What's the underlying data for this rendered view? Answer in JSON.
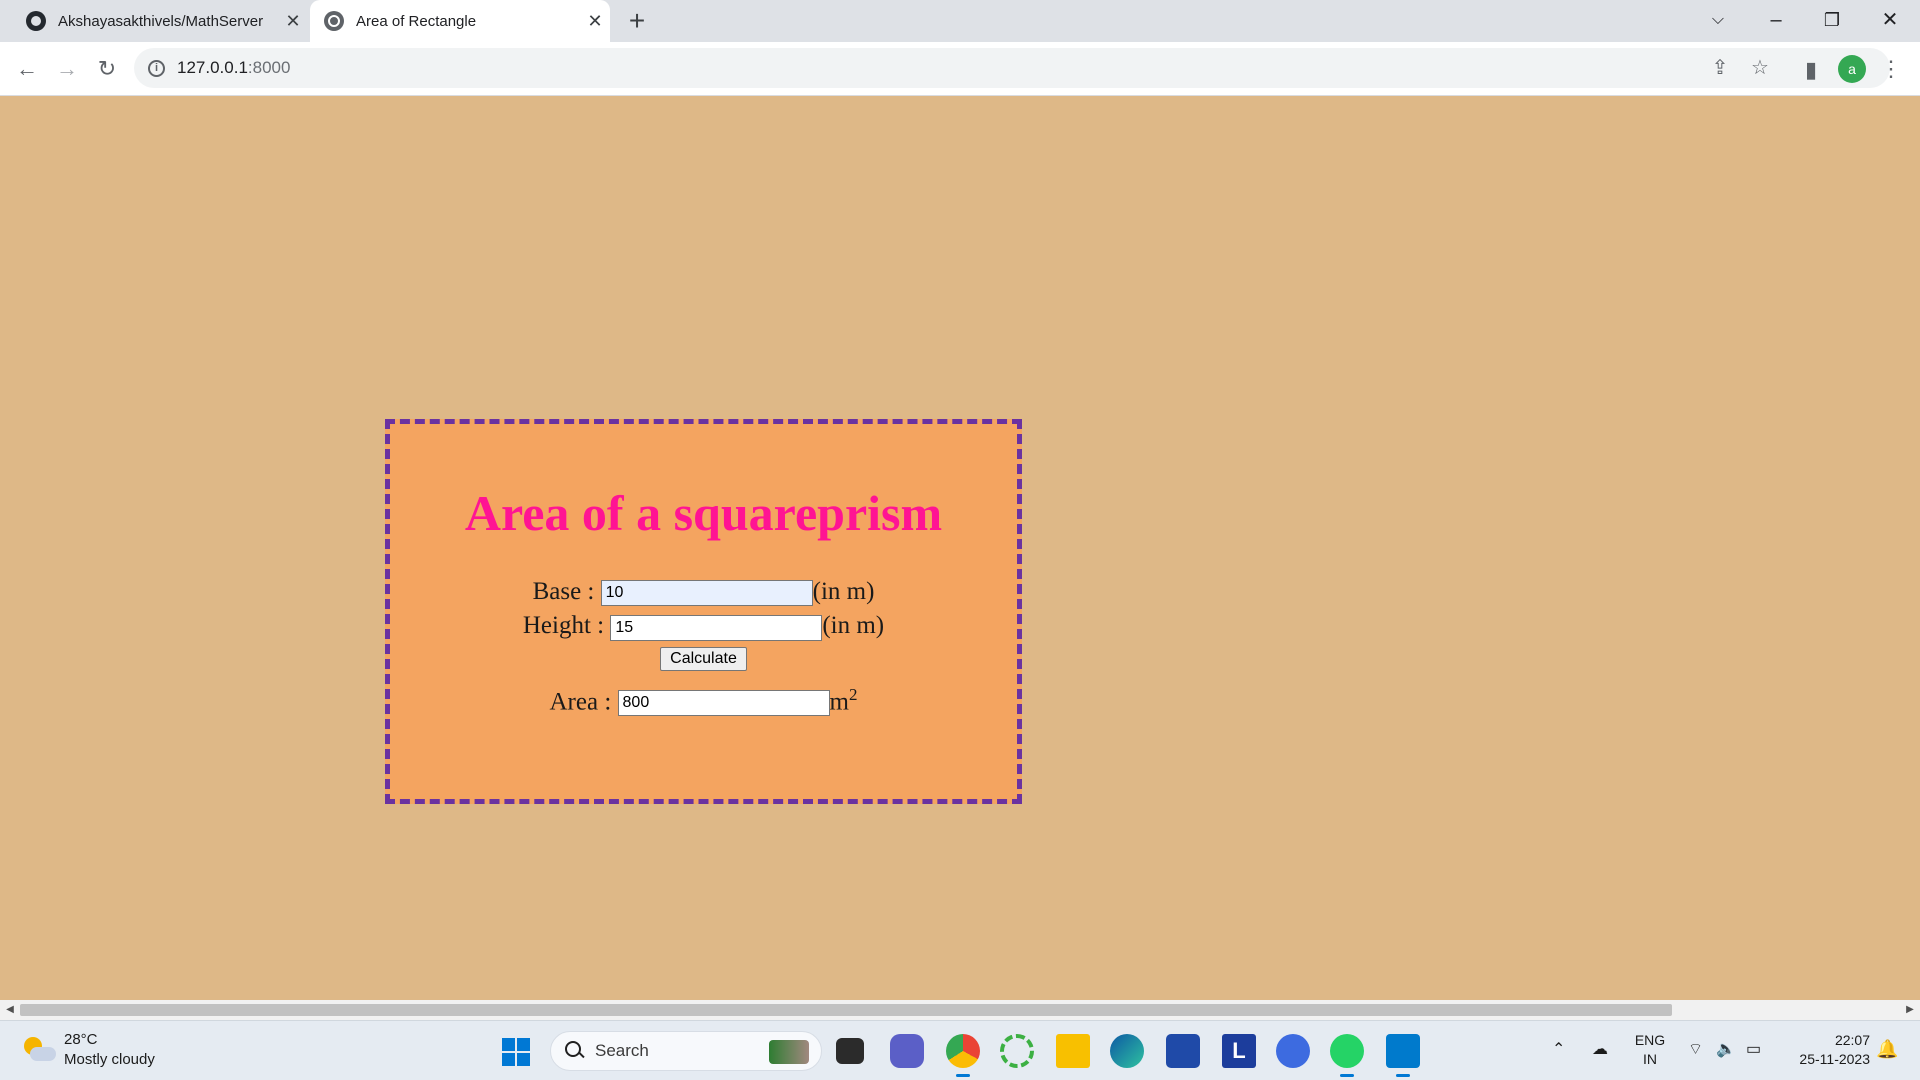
{
  "browser": {
    "tabs": [
      {
        "title": "Akshayasakthivels/MathServer",
        "icon": "github-icon"
      },
      {
        "title": "Area of Rectangle",
        "icon": "globe-icon"
      }
    ],
    "url_host": "127.0.0.1",
    "url_port": ":8000",
    "profile_initial": "a"
  },
  "page": {
    "heading": "Area of a squareprism",
    "base": {
      "label": "Base :",
      "value": "10",
      "unit": "(in m)"
    },
    "height": {
      "label": "Height :",
      "value": "15",
      "unit": "(in m)"
    },
    "calculate_label": "Calculate",
    "area": {
      "label": "Area :",
      "value": "800",
      "unit": "m",
      "unit_sup": "2"
    }
  },
  "taskbar": {
    "weather_temp": "28°C",
    "weather_desc": "Mostly cloudy",
    "search_label": "Search",
    "lang_line1": "ENG",
    "lang_line2": "IN",
    "time": "22:07",
    "date": "25-11-2023"
  },
  "colors": {
    "page_bg": "#deb887",
    "card_bg": "#f4a460",
    "card_border": "#6a32a0",
    "heading": "#ff1493"
  }
}
